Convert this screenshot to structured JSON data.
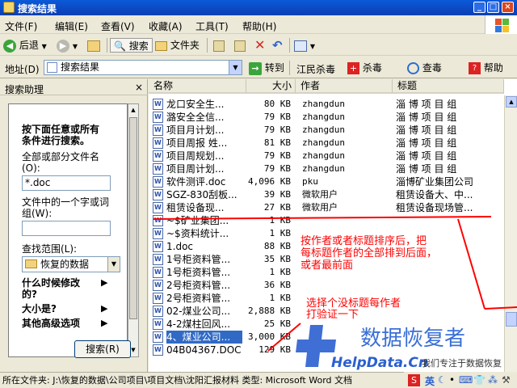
{
  "window": {
    "title": "搜索结果",
    "min": "_",
    "max": "□",
    "close": "×"
  },
  "menu": [
    "文件(F)",
    "编辑(E)",
    "查看(V)",
    "收藏(A)",
    "工具(T)",
    "帮助(H)"
  ],
  "toolbar": {
    "back": "后退",
    "search": "搜索",
    "folders": "文件夹"
  },
  "address": {
    "label": "地址(D)",
    "value": "搜索结果",
    "go": "转到"
  },
  "extras": {
    "jiangmin": "江民杀毒",
    "kill": "杀毒",
    "lookup": "查毒",
    "help": "帮助"
  },
  "left": {
    "title": "搜索助理",
    "close": "×",
    "intro1": "按下面任意或所有",
    "intro2": "条件进行搜索。",
    "label_name1": "全部或部分文件名",
    "label_name2": "(O):",
    "name_value": "*.doc",
    "label_word1": "文件中的一个字或词",
    "label_word2": "组(W):",
    "word_value": "",
    "label_scope": "查找范围(L):",
    "scope_value": "恢复的数据",
    "opt_when": "什么时候修改",
    "opt_when2": "的?",
    "opt_size": "大小是?",
    "opt_adv": "其他高级选项",
    "search_button": "搜索(R)"
  },
  "columns": {
    "name": "名称",
    "size": "大小",
    "author": "作者",
    "subject": "标题"
  },
  "rows": [
    {
      "name": "龙口安全生...",
      "size": "80 KB",
      "author": "zhangdun",
      "subject": "淄 博 项 目 组"
    },
    {
      "name": "潞安全全信...",
      "size": "79 KB",
      "author": "zhangdun",
      "subject": "淄 博 项 目 组"
    },
    {
      "name": "项目月计划...",
      "size": "79 KB",
      "author": "zhangdun",
      "subject": "淄 博 项 目 组"
    },
    {
      "name": "项目周报 姓...",
      "size": "81 KB",
      "author": "zhangdun",
      "subject": "淄 博 项 目 组"
    },
    {
      "name": "项目周规划...",
      "size": "79 KB",
      "author": "zhangdun",
      "subject": "淄 博 项 目 组"
    },
    {
      "name": "项目周计划...",
      "size": "79 KB",
      "author": "zhangdun",
      "subject": "淄 博 项 目 组"
    },
    {
      "name": "软件测评.doc",
      "size": "4,096 KB",
      "author": "pku",
      "subject": "淄博矿业集团公司"
    },
    {
      "name": "SGZ-830刮板...",
      "size": "39 KB",
      "author": "微软用户",
      "subject": "租赁设备大、中..."
    },
    {
      "name": "租赁设备现...",
      "size": "27 KB",
      "author": "微软用户",
      "subject": "租赁设备现场管..."
    },
    {
      "name": "~$矿业集团...",
      "size": "1 KB",
      "author": "",
      "subject": ""
    },
    {
      "name": "~$资料统计...",
      "size": "1 KB",
      "author": "",
      "subject": ""
    },
    {
      "name": "1.doc",
      "size": "88 KB",
      "author": "",
      "subject": ""
    },
    {
      "name": "1号柜资料管...",
      "size": "35 KB",
      "author": "",
      "subject": ""
    },
    {
      "name": "1号柜资料管...",
      "size": "1 KB",
      "author": "",
      "subject": ""
    },
    {
      "name": "2号柜资料管...",
      "size": "36 KB",
      "author": "",
      "subject": ""
    },
    {
      "name": "2号柜资料管...",
      "size": "1 KB",
      "author": "",
      "subject": ""
    },
    {
      "name": "02-煤业公司...",
      "size": "2,888 KB",
      "author": "",
      "subject": ""
    },
    {
      "name": "4-2煤柱回风...",
      "size": "25 KB",
      "author": "",
      "subject": ""
    },
    {
      "name": "4、煤业公司...",
      "size": "3,000 KB",
      "author": "",
      "subject": ""
    },
    {
      "name": "04B04367.DOC",
      "size": "129 KB",
      "author": "",
      "subject": ""
    }
  ],
  "annotations": {
    "a1": "按作者或者标题排序后，把",
    "a2": "每标题作者的全部排到后面，",
    "a3": "或者最前面",
    "b1": "选择个没标题每作者",
    "b2": "打验证一下"
  },
  "watermark": {
    "cn": "数据恢复者",
    "url": "HelpData.Cn",
    "slogan": "我们专注于数据恢复"
  },
  "status": "所在文件夹: J:\\恢复的数据\\公司项目\\项目文档\\沈阳汇报材料 类型: Microsoft Word 文档",
  "tray": {
    "ime": "英",
    "moon": "☾",
    "dot": "•",
    "a": "⁂"
  }
}
